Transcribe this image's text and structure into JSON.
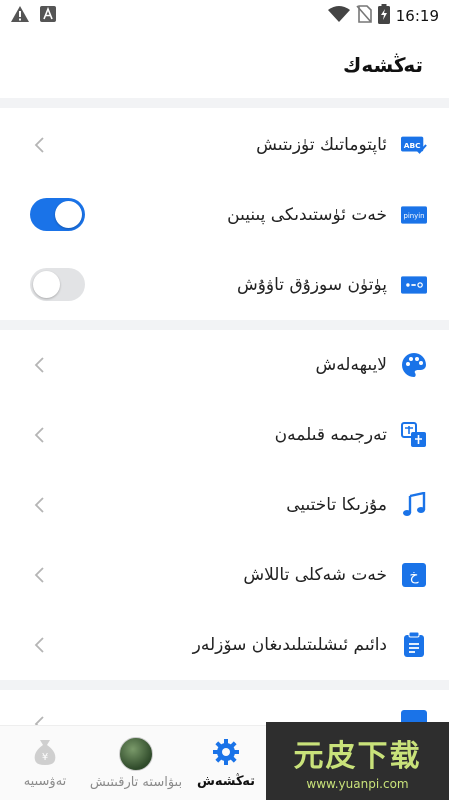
{
  "statusbar": {
    "time": "16:19"
  },
  "header": {
    "title": "تەڭشەك"
  },
  "settings": {
    "auto_correct": "ئاپتوماتىك تۈزىتىش",
    "pinyin_input": "خەت ئۈستىدىكى پىنيىن",
    "full_key_sound": "پۈتۈن سوزۇق تاۋۇش",
    "pinyin_toggle_on": true,
    "sound_toggle_on": false,
    "theme": "لايىھەلەش",
    "translate": "تەرجىمە قىلمەن",
    "music": "مۇزىكا تاختىيى",
    "font_style": "خەت شەكلى تاللاش",
    "phrases": "دائىم ئىشلىتىلىدىغان سۆزلەر",
    "abc_icon_text": "ABC",
    "pinyin_icon_text": "pinyin",
    "font_icon_text": "خ"
  },
  "bottomnav": {
    "settings": "تەڭشەش",
    "profile": "بىۋاستە تارقىتىش",
    "money": "تەۋسىيە"
  },
  "watermark": {
    "main": "元皮下载",
    "sub": "www.yuanpi.com"
  },
  "colors": {
    "accent": "#1a73e8",
    "toggle_off": "#e2e3e5",
    "separator": "#f2f3f5"
  }
}
